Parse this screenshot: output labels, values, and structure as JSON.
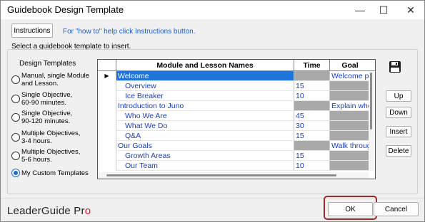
{
  "window": {
    "title": "Guidebook Design Template",
    "minimize_glyph": "—",
    "maximize_glyph": "☐",
    "close_glyph": "✕"
  },
  "toolbar": {
    "instructions_label": "Instructions",
    "hint": "For \"how to\" help click Instructions button."
  },
  "section_label": "Select a guidebook template to insert.",
  "templates": {
    "heading": "Design Templates",
    "options": [
      {
        "label": "Manual, single Module and Lesson.",
        "checked": false
      },
      {
        "label": "Single Objective, 60-90 minutes.",
        "checked": false
      },
      {
        "label": "Single Objective, 90-120 minutes.",
        "checked": false
      },
      {
        "label": "Multiple Objectives, 3-4 hours.",
        "checked": false
      },
      {
        "label": "Multiple Objectives, 5-6 hours.",
        "checked": false
      },
      {
        "label": "My Custom Templates",
        "checked": true
      }
    ]
  },
  "grid": {
    "columns": [
      "Module and Lesson Names",
      "Time",
      "Goal"
    ],
    "rows": [
      {
        "indicator": "▶",
        "name": "Welcome",
        "indent": false,
        "time": "",
        "goal": "Welcome p",
        "selected": true
      },
      {
        "indicator": "",
        "name": "Overview",
        "indent": true,
        "time": "15",
        "goal": "",
        "selected": false
      },
      {
        "indicator": "",
        "name": "Ice Breaker",
        "indent": true,
        "time": "10",
        "goal": "",
        "selected": false
      },
      {
        "indicator": "",
        "name": "Introduction to Juno",
        "indent": false,
        "time": "",
        "goal": "Explain who",
        "selected": false
      },
      {
        "indicator": "",
        "name": "Who We Are",
        "indent": true,
        "time": "45",
        "goal": "",
        "selected": false
      },
      {
        "indicator": "",
        "name": "What We Do",
        "indent": true,
        "time": "30",
        "goal": "",
        "selected": false
      },
      {
        "indicator": "",
        "name": "Q&A",
        "indent": true,
        "time": "15",
        "goal": "",
        "selected": false
      },
      {
        "indicator": "",
        "name": "Our Goals",
        "indent": false,
        "time": "",
        "goal": "Walk throug",
        "selected": false
      },
      {
        "indicator": "",
        "name": "Growth Areas",
        "indent": true,
        "time": "15",
        "goal": "",
        "selected": false
      },
      {
        "indicator": "",
        "name": "Our Team",
        "indent": true,
        "time": "10",
        "goal": "",
        "selected": false
      }
    ]
  },
  "side_buttons": {
    "save_icon": "floppy-disk",
    "up": "Up",
    "down": "Down",
    "insert": "Insert",
    "delete": "Delete"
  },
  "footer": {
    "logo_main": "LeaderGuide Pr",
    "logo_accent": "o",
    "ok": "OK",
    "cancel": "Cancel"
  },
  "colors": {
    "selection": "#1e74d8",
    "link_text": "#1a3fbf",
    "gray_cell": "#a9a9a9",
    "ok_highlight": "#9c2a2a",
    "logo_accent": "#d11a2a"
  }
}
